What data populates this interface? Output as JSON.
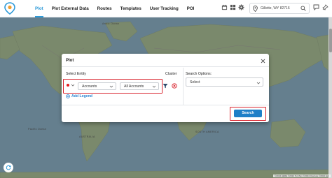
{
  "nav": {
    "items": [
      {
        "label": "Plot",
        "active": true
      },
      {
        "label": "Plot External Data"
      },
      {
        "label": "Routes"
      },
      {
        "label": "Templates"
      },
      {
        "label": "User Tracking"
      },
      {
        "label": "POI"
      }
    ]
  },
  "location": {
    "value": "Gillette, WY 82716"
  },
  "map": {
    "labels": {
      "arctic": "Arctic Ocean",
      "pacific": "Pacific Ocean",
      "south_america": "SOUTH AMERICA",
      "australia": "AUSTRALIA"
    },
    "attribution": "©2024 HERE ©2024 TomTom ©2024 Overture ©2024 Esri"
  },
  "modal": {
    "title": "Plot",
    "select_entity_label": "Select Entity",
    "cluster_label": "Cluster",
    "search_options_label": "Search Options:",
    "entity_select": "Accounts",
    "filter_select": "All Accounts",
    "search_options_placeholder": "Select",
    "add_legend": "Add Legend",
    "search_button": "Search"
  },
  "colors": {
    "accent": "#2e9ad8",
    "highlight": "#d9232d",
    "legend_dot": "#e31b1b",
    "button": "#1e7fc7",
    "water": "#a8d4ed",
    "land": "#cbe4b4"
  },
  "icons": [
    "app-logo-icon",
    "calendar-icon",
    "grid-icon",
    "gear-icon",
    "location-pin-icon",
    "search-icon",
    "chat-icon",
    "pin-off-icon",
    "refresh-icon",
    "close-icon",
    "filter-icon",
    "remove-circle-icon",
    "add-circle-icon",
    "chevron-down-icon"
  ]
}
